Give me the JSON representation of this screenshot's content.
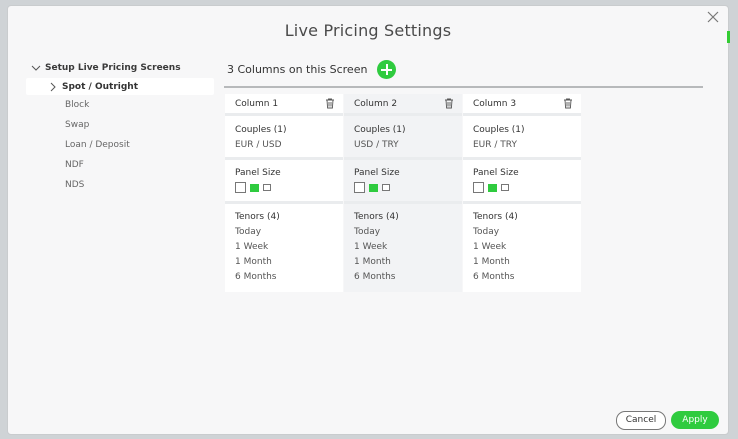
{
  "dialog": {
    "title": "Live Pricing Settings"
  },
  "sidebar": {
    "root_label": "Setup Live Pricing Screens",
    "selected_label": "Spot / Outright",
    "items": [
      "Block",
      "Swap",
      "Loan / Deposit",
      "NDF",
      "NDS"
    ]
  },
  "main": {
    "columns_label": "3 Columns on this Screen",
    "columns": [
      {
        "name": "Column 1",
        "couples_title": "Couples (1)",
        "couples": [
          "EUR / USD"
        ],
        "panel_title": "Panel Size",
        "panel_selected": "medium",
        "tenors_title": "Tenors (4)",
        "tenors": [
          "Today",
          "1 Week",
          "1 Month",
          "6 Months"
        ]
      },
      {
        "name": "Column 2",
        "couples_title": "Couples (1)",
        "couples": [
          "USD / TRY"
        ],
        "panel_title": "Panel Size",
        "panel_selected": "medium",
        "tenors_title": "Tenors (4)",
        "tenors": [
          "Today",
          "1 Week",
          "1 Month",
          "6 Months"
        ]
      },
      {
        "name": "Column 3",
        "couples_title": "Couples (1)",
        "couples": [
          "EUR / TRY"
        ],
        "panel_title": "Panel Size",
        "panel_selected": "medium",
        "tenors_title": "Tenors (4)",
        "tenors": [
          "Today",
          "1 Week",
          "1 Month",
          "6 Months"
        ]
      }
    ]
  },
  "footer": {
    "cancel_label": "Cancel",
    "apply_label": "Apply"
  },
  "colors": {
    "accent": "#2fcb3f"
  },
  "icons": {
    "close": "close-icon",
    "add": "plus-icon",
    "trash": "trash-icon",
    "tree_collapse": "chevron-down-icon",
    "tree_item": "chevron-right-icon"
  }
}
